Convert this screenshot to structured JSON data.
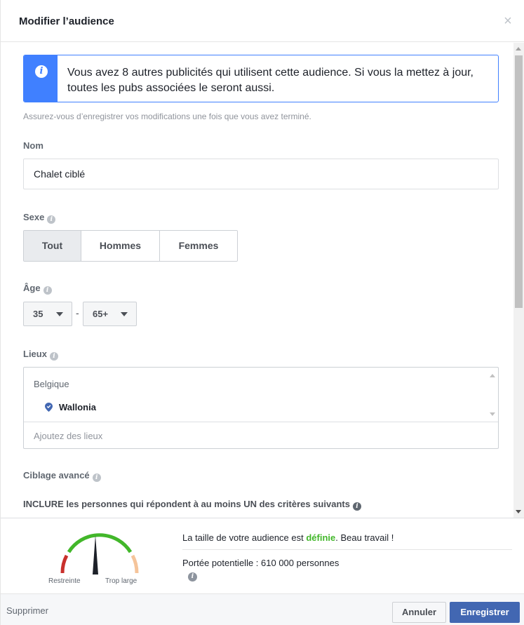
{
  "dialog": {
    "title": "Modifier l’audience",
    "close_icon": "close-icon",
    "close_glyph": "×"
  },
  "notice": {
    "icon": "info-icon",
    "text": "Vous avez 8 autres publicités qui utilisent cette audience. Si vous la mettez à jour, toutes les pubs associées le seront aussi."
  },
  "hint": "Assurez-vous d’enregistrer vos modifications une fois que vous avez terminé.",
  "name_field": {
    "label": "Nom",
    "value": "Chalet ciblé"
  },
  "gender": {
    "label": "Sexe",
    "options": [
      "Tout",
      "Hommes",
      "Femmes"
    ],
    "selected": "Tout"
  },
  "age": {
    "label": "Âge",
    "min": "35",
    "max": "65+",
    "separator": "-"
  },
  "locations": {
    "label": "Lieux",
    "country": "Belgique",
    "region": "Wallonia",
    "placeholder": "Ajoutez des lieux"
  },
  "targeting": {
    "label": "Ciblage avancé",
    "include_text": "INCLURE les personnes qui répondent à au moins UN des critères suivants"
  },
  "audience": {
    "status_prefix": "La taille de votre audience est ",
    "status_word": "définie",
    "status_suffix": ". Beau travail !",
    "reach": "Portée potentielle : 610 000 personnes",
    "gauge_left": "Restreinte",
    "gauge_right": "Trop large",
    "gauge_level": 0.5
  },
  "footer": {
    "delete": "Supprimer",
    "cancel": "Annuler",
    "save": "Enregistrer"
  },
  "colors": {
    "accent": "#4267b2",
    "notice_blue": "#4080ff",
    "ok_green": "#42b72a"
  }
}
